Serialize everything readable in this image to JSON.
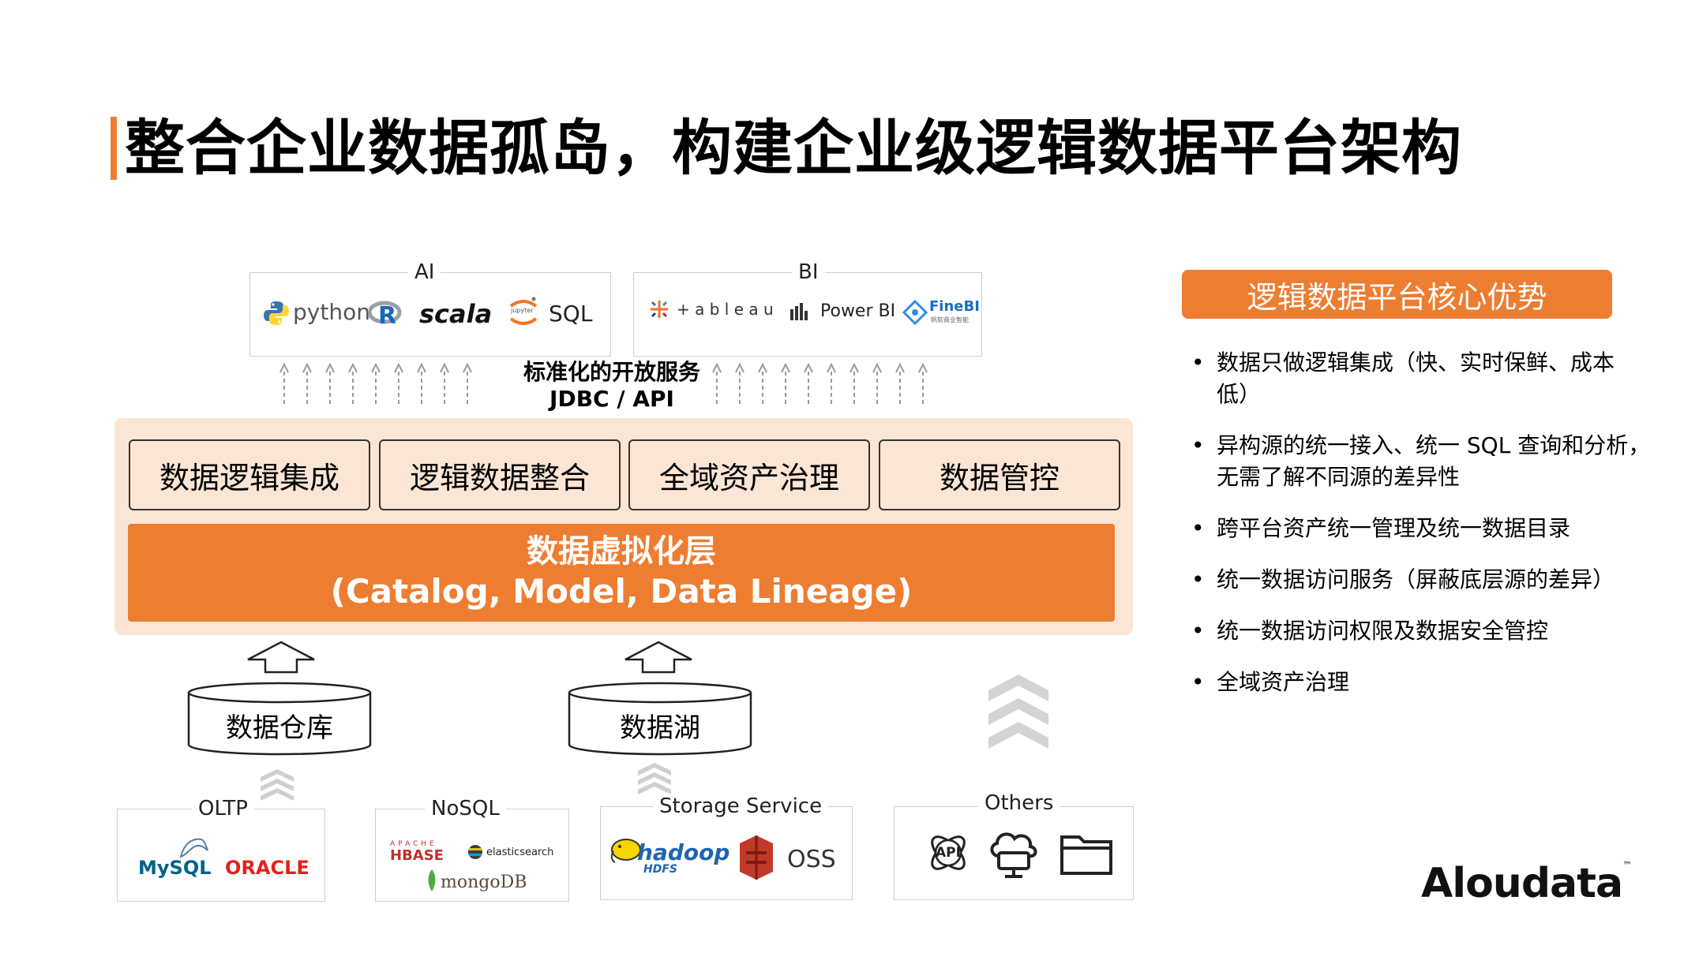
{
  "page": {
    "title": "整合企业数据孤岛，构建企业级逻辑数据平台架构",
    "brand": "Aloudata",
    "brand_tm": "™"
  },
  "colors": {
    "accent": "#ed7d31",
    "platform_bg": "#fbe5d4"
  },
  "consumers": {
    "ai": {
      "label": "AI",
      "items": [
        "python",
        "R",
        "scala",
        "jupyter",
        "SQL"
      ]
    },
    "bi": {
      "label": "BI",
      "items": [
        "+ a b l e a u",
        "Power BI",
        "FineBI",
        "帆软商业智能"
      ]
    }
  },
  "service": {
    "line1": "标准化的开放服务",
    "line2": "JDBC / API"
  },
  "platform": {
    "modules": [
      "数据逻辑集成",
      "逻辑数据整合",
      "全域资产治理",
      "数据管控"
    ],
    "layer_title": "数据虚拟化层",
    "layer_subtitle": "(Catalog, Model, Data Lineage)"
  },
  "stores": {
    "warehouse": "数据仓库",
    "lake": "数据湖"
  },
  "sources": {
    "oltp": {
      "label": "OLTP",
      "items": [
        "MySQL",
        "ORACLE"
      ]
    },
    "nosql": {
      "label": "NoSQL",
      "items": [
        "APACHE",
        "HBASE",
        "elasticsearch",
        "mongoDB"
      ]
    },
    "storage": {
      "label": "Storage Service",
      "items": [
        "hadoop",
        "HDFS",
        "OSS"
      ]
    },
    "others": {
      "label": "Others",
      "items": [
        "API"
      ]
    }
  },
  "advantages": {
    "title": "逻辑数据平台核心优势",
    "items": [
      "数据只做逻辑集成（快、实时保鲜、成本低）",
      "异构源的统一接入、统一 SQL 查询和分析，无需了解不同源的差异性",
      "跨平台资产统一管理及统一数据目录",
      "统一数据访问服务（屏蔽底层源的差异）",
      "统一数据访问权限及数据安全管控",
      "全域资产治理"
    ]
  },
  "icons": [
    "python-icon",
    "r-icon",
    "jupyter-icon",
    "tableau-icon",
    "powerbi-icon",
    "finebi-icon",
    "mysql-dolphin-icon",
    "elasticsearch-icon",
    "mongodb-leaf-icon",
    "hadoop-elephant-icon",
    "oss-icon",
    "api-icon",
    "cloud-computer-icon",
    "folder-icon",
    "chevron-up-stack-icon",
    "hollow-up-arrow-icon"
  ]
}
